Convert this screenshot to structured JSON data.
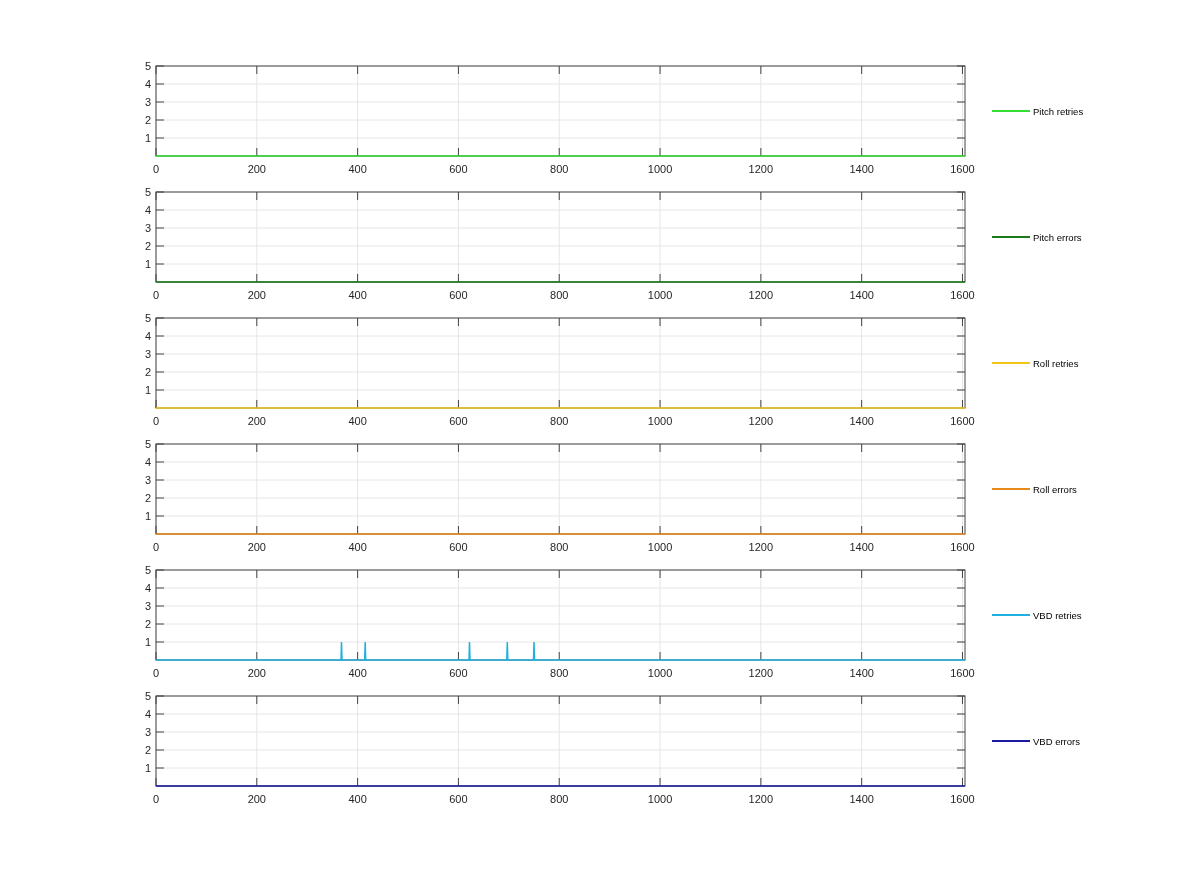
{
  "subplots": [
    {
      "chart_data": {
        "type": "line",
        "x": [
          0,
          1605
        ],
        "series": [
          {
            "name": "Pitch retries",
            "color": "#33dd33",
            "values": [
              0,
              0
            ]
          }
        ],
        "xlim": [
          0,
          1605
        ],
        "ylim": [
          0,
          5
        ],
        "xticks": [
          0,
          200,
          400,
          600,
          800,
          1000,
          1200,
          1400,
          1600
        ],
        "yticks": [
          1,
          2,
          3,
          4,
          5
        ],
        "grid": true
      }
    },
    {
      "chart_data": {
        "type": "line",
        "x": [
          0,
          1605
        ],
        "series": [
          {
            "name": "Pitch errors",
            "color": "#1a7a1a",
            "values": [
              0,
              0
            ]
          }
        ],
        "xlim": [
          0,
          1605
        ],
        "ylim": [
          0,
          5
        ],
        "xticks": [
          0,
          200,
          400,
          600,
          800,
          1000,
          1200,
          1400,
          1600
        ],
        "yticks": [
          1,
          2,
          3,
          4,
          5
        ],
        "grid": true
      }
    },
    {
      "chart_data": {
        "type": "line",
        "x": [
          0,
          1605
        ],
        "series": [
          {
            "name": "Roll retries",
            "color": "#f5c518",
            "values": [
              0,
              0
            ]
          }
        ],
        "xlim": [
          0,
          1605
        ],
        "ylim": [
          0,
          5
        ],
        "xticks": [
          0,
          200,
          400,
          600,
          800,
          1000,
          1200,
          1400,
          1600
        ],
        "yticks": [
          1,
          2,
          3,
          4,
          5
        ],
        "grid": true
      }
    },
    {
      "chart_data": {
        "type": "line",
        "x": [
          0,
          1605
        ],
        "series": [
          {
            "name": "Roll errors",
            "color": "#e8891c",
            "values": [
              0,
              0
            ]
          }
        ],
        "xlim": [
          0,
          1605
        ],
        "ylim": [
          0,
          5
        ],
        "xticks": [
          0,
          200,
          400,
          600,
          800,
          1000,
          1200,
          1400,
          1600
        ],
        "yticks": [
          1,
          2,
          3,
          4,
          5
        ],
        "grid": true
      }
    },
    {
      "chart_data": {
        "type": "line",
        "x": [
          0,
          367,
          368,
          369,
          414,
          415,
          416,
          621,
          622,
          623,
          696,
          697,
          698,
          749,
          750,
          751,
          1605
        ],
        "series": [
          {
            "name": "VBD retries",
            "color": "#1fb0e0",
            "values": [
              0,
              0,
              1,
              0,
              0,
              1,
              0,
              0,
              1,
              0,
              0,
              1,
              0,
              0,
              1,
              0,
              0
            ]
          }
        ],
        "xlim": [
          0,
          1605
        ],
        "ylim": [
          0,
          5
        ],
        "xticks": [
          0,
          200,
          400,
          600,
          800,
          1000,
          1200,
          1400,
          1600
        ],
        "yticks": [
          1,
          2,
          3,
          4,
          5
        ],
        "grid": true
      }
    },
    {
      "chart_data": {
        "type": "line",
        "x": [
          0,
          1605
        ],
        "series": [
          {
            "name": "VBD errors",
            "color": "#1a1aa0",
            "values": [
              0,
              0
            ]
          }
        ],
        "xlim": [
          0,
          1605
        ],
        "ylim": [
          0,
          5
        ],
        "xticks": [
          0,
          200,
          400,
          600,
          800,
          1000,
          1200,
          1400,
          1600
        ],
        "yticks": [
          1,
          2,
          3,
          4,
          5
        ],
        "grid": true
      }
    }
  ]
}
